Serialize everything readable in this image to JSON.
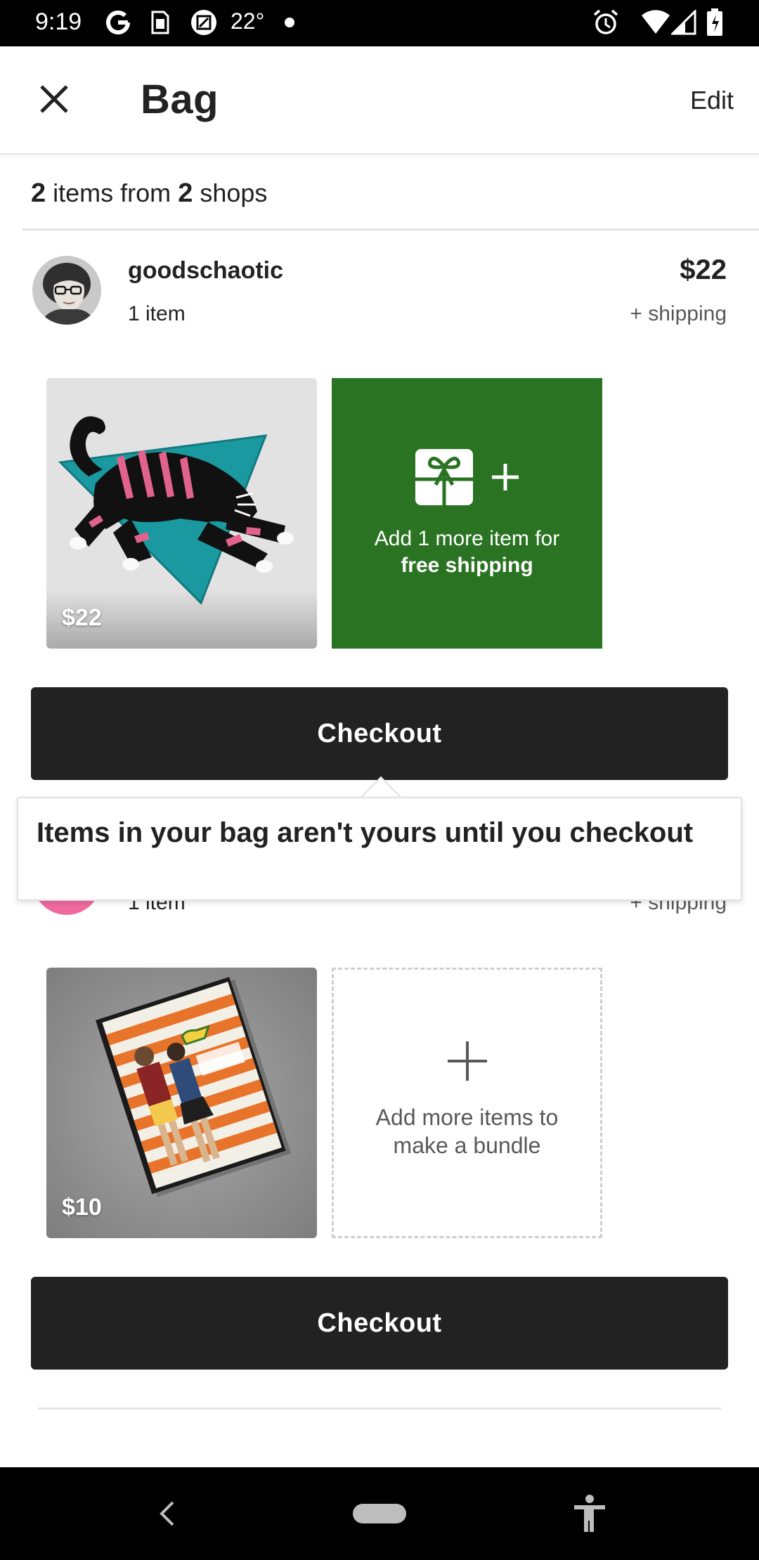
{
  "status_bar": {
    "time": "9:19",
    "temperature": "22°"
  },
  "header": {
    "title": "Bag",
    "edit_label": "Edit"
  },
  "summary": {
    "item_count": "2",
    "items_text": "items from",
    "shop_count": "2",
    "shops_text": "shops"
  },
  "shops": [
    {
      "name": "goodschaotic",
      "count": "1 item",
      "price": "$22",
      "shipping": "+ shipping",
      "item_price": "$22",
      "promo_line1": "Add 1 more item for",
      "promo_line2": "free shipping",
      "checkout_label": "Checkout"
    },
    {
      "count": "1 item",
      "shipping": "+ shipping",
      "item_price": "$10",
      "bundle_line1": "Add more items to",
      "bundle_line2": "make a bundle",
      "checkout_label": "Checkout"
    }
  ],
  "tooltip": {
    "text": "Items in your bag aren't yours until you checkout"
  },
  "colors": {
    "promo_green": "#2a7322",
    "button_dark": "#222222",
    "avatar_pink": "#f06aa0"
  }
}
